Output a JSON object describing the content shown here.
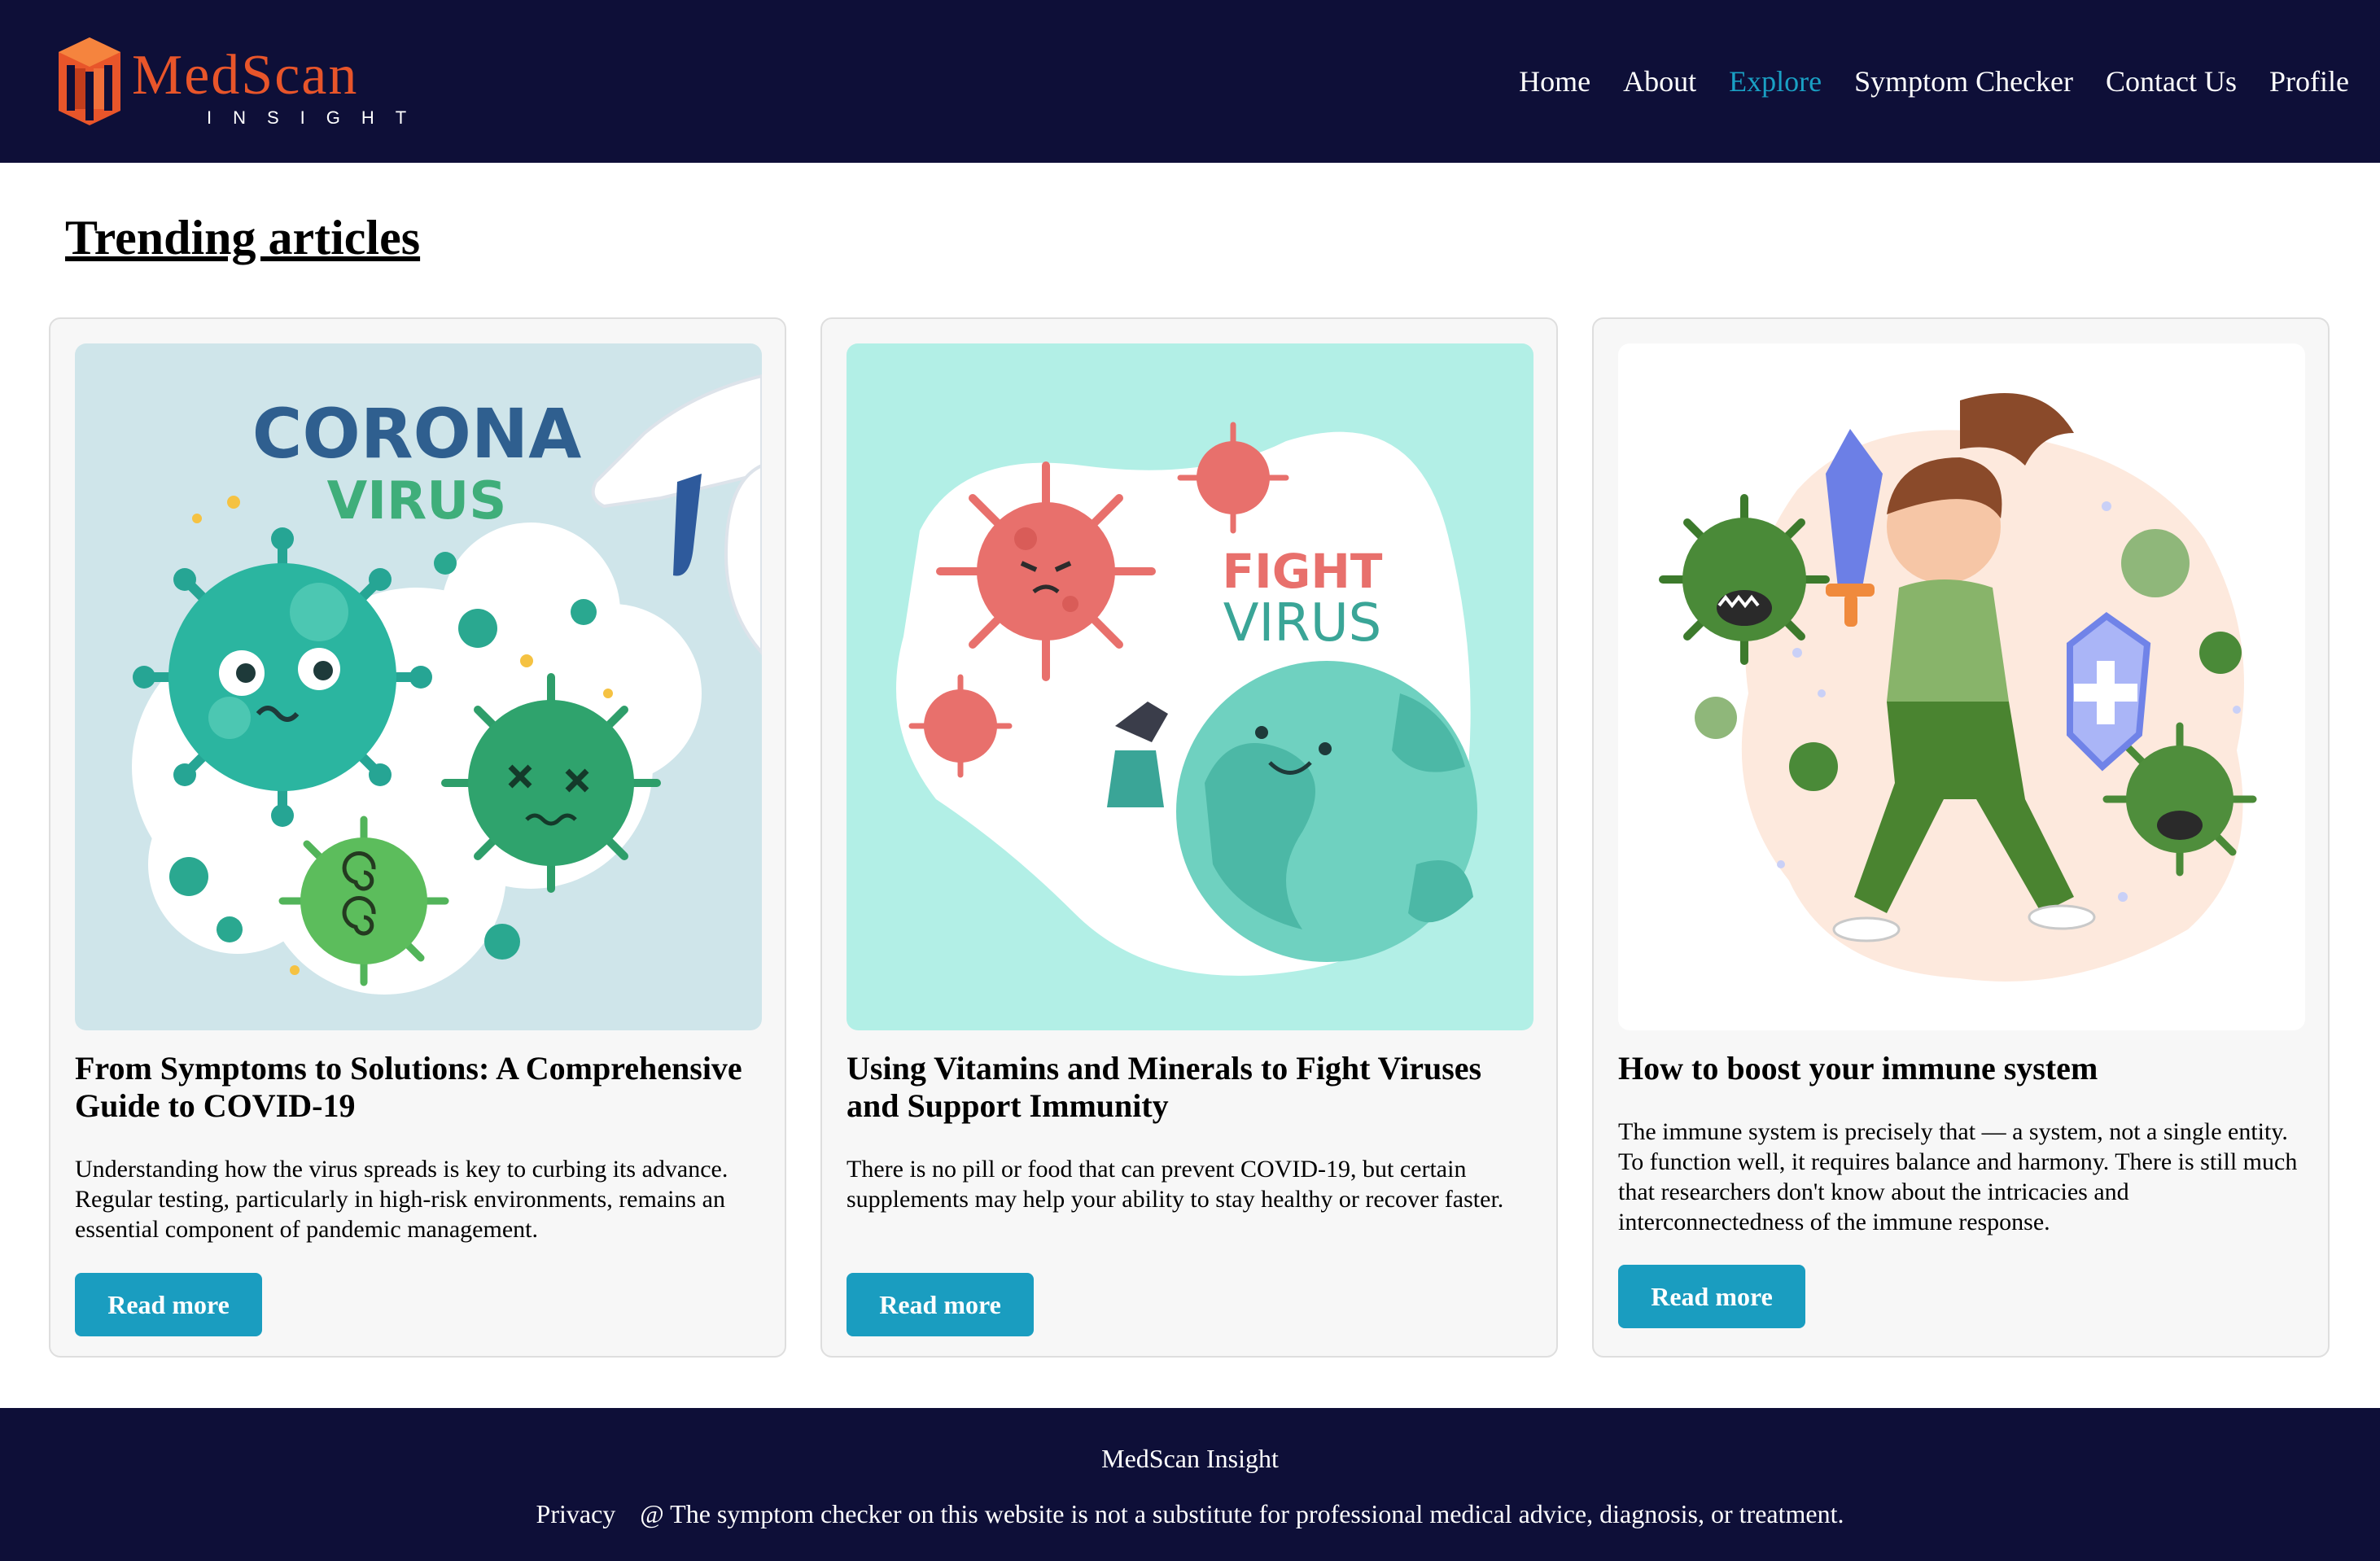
{
  "header": {
    "logo": {
      "name": "MedScan",
      "tagline": "INSIGHT",
      "icon": "building-logo-icon"
    },
    "nav": [
      {
        "label": "Home"
      },
      {
        "label": "About"
      },
      {
        "label": "Explore",
        "active": true
      },
      {
        "label": "Symptom Checker"
      },
      {
        "label": "Contact Us"
      },
      {
        "label": "Profile"
      }
    ]
  },
  "colors": {
    "header_bg": "#0e0f38",
    "accent": "#1a9dc0",
    "logo_orange": "#e8552a",
    "card_bg": "#f7f7f7"
  },
  "main": {
    "section_title": "Trending articles",
    "cards": [
      {
        "image_text": [
          "CORONA",
          "VIRUS"
        ],
        "title": "From Symptoms to Solutions: A Comprehensive Guide to COVID-19",
        "text": "Understanding how the virus spreads is key to curbing its advance. Regular testing, particularly in high-risk environments, remains an essential component of pandemic management.",
        "button": "Read more"
      },
      {
        "image_text": [
          "FIGHT",
          "VIRUS"
        ],
        "title": "Using Vitamins and Minerals to Fight Viruses and Support Immunity",
        "text": "There is no pill or food that can prevent COVID-19, but certain supplements may help your ability to stay healthy or recover faster.",
        "button": "Read more"
      },
      {
        "title": "How to boost your immune system",
        "text": "The immune system is precisely that — a system, not a single entity. To function well, it requires balance and harmony. There is still much that researchers don't know about the intricacies and interconnectedness of the immune response.",
        "button": "Read more"
      }
    ]
  },
  "footer": {
    "brand": "MedScan Insight",
    "privacy": "Privacy",
    "disclaimer": "@ The symptom checker on this website is not a substitute for professional medical advice, diagnosis, or treatment."
  }
}
